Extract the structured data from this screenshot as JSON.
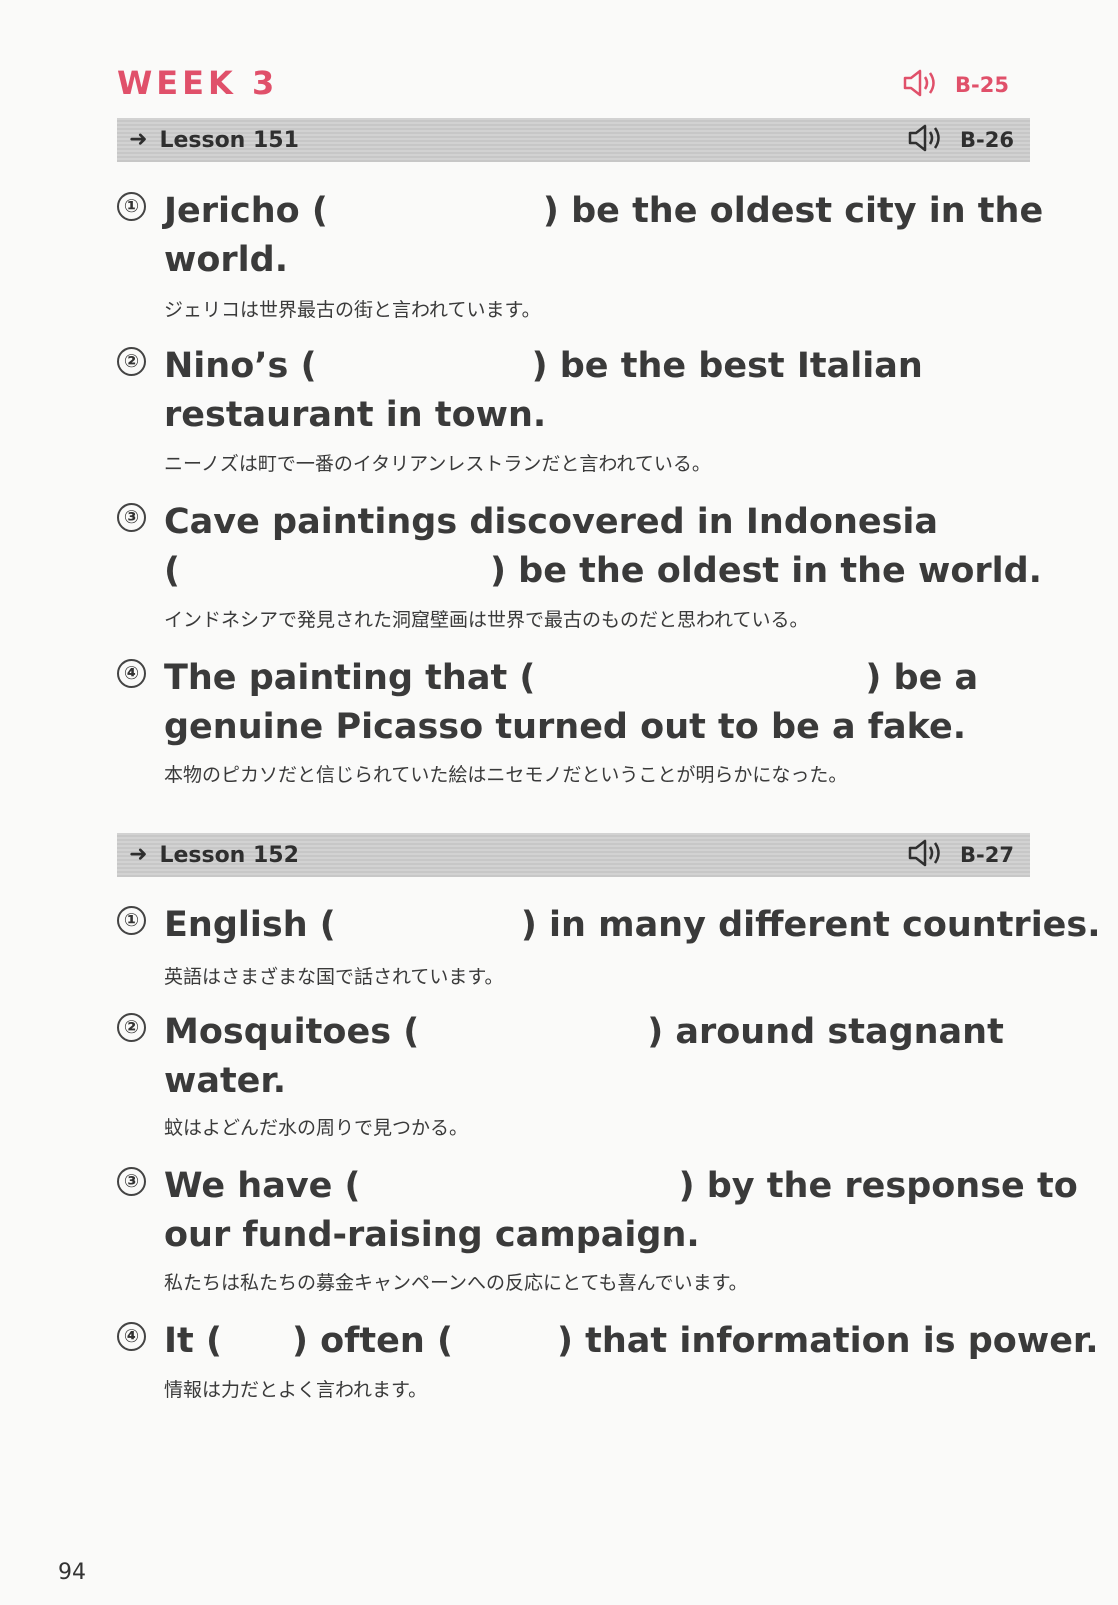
{
  "header": {
    "week_title": "WEEK 3",
    "audio_code": "B-25",
    "audio_icon": "speaker-icon",
    "accent_color": "#e0506a"
  },
  "lessons": [
    {
      "title": "Lesson 151",
      "audio_code": "B-26",
      "items": [
        {
          "number": "①",
          "lines": [
            [
              "Jericho (",
              ") be the oldest city in the"
            ],
            [
              "world."
            ]
          ],
          "translation": "ジェリコは世界最古の街と言われています。"
        },
        {
          "number": "②",
          "lines": [
            [
              "Nino’s (",
              ") be the best Italian"
            ],
            [
              "restaurant in town."
            ]
          ],
          "translation": "ニーノズは町で一番のイタリアンレストランだと言われている。"
        },
        {
          "number": "③",
          "lines": [
            [
              "Cave paintings discovered in Indonesia"
            ],
            [
              "(",
              ") be the oldest in the world."
            ]
          ],
          "translation": "インドネシアで発見された洞窟壁画は世界で最古のものだと思われている。"
        },
        {
          "number": "④",
          "lines": [
            [
              "The painting that (",
              ") be a"
            ],
            [
              "genuine Picasso turned out to be a fake."
            ]
          ],
          "translation": "本物のピカソだと信じられていた絵はニセモノだということが明らかになった。"
        }
      ]
    },
    {
      "title": "Lesson 152",
      "audio_code": "B-27",
      "items": [
        {
          "number": "①",
          "lines": [
            [
              "English (",
              ") in many different countries."
            ]
          ],
          "translation": "英語はさまざまな国で話されています。"
        },
        {
          "number": "②",
          "lines": [
            [
              "Mosquitoes (",
              ") around stagnant"
            ],
            [
              "water."
            ]
          ],
          "translation": "蚊はよどんだ水の周りで見つかる。"
        },
        {
          "number": "③",
          "lines": [
            [
              "We have (",
              ") by the response to"
            ],
            [
              "our fund-raising campaign."
            ]
          ],
          "translation": "私たちは私たちの募金キャンペーンへの反応にとても喜んでいます。"
        },
        {
          "number": "④",
          "lines": [
            [
              "It (",
              ") often (",
              ") that information is power."
            ]
          ],
          "translation": "情報は力だとよく言われます。"
        }
      ]
    }
  ],
  "page_number": "94"
}
